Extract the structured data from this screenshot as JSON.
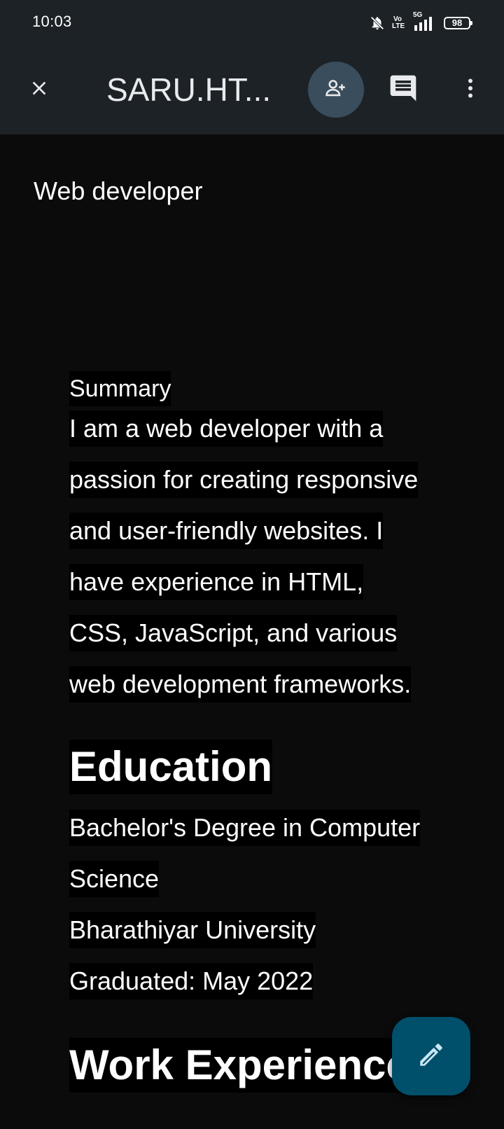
{
  "status_bar": {
    "time": "10:03",
    "volte_label": "Vo LTE",
    "network": "5G",
    "battery": "98",
    "icons": [
      "bell-off-icon",
      "volte-icon",
      "signal-icon",
      "battery-icon"
    ]
  },
  "app_bar": {
    "title": "SARU.HT...",
    "icons": [
      "close-icon",
      "person-add-icon",
      "comment-icon",
      "more-vert-icon"
    ],
    "share_bg_color": "#394d5c"
  },
  "document": {
    "subtitle": "Web developer",
    "summary_label": "Summary",
    "summary_lines": [
      "I am a web developer with a",
      "passion for creating responsive",
      "and user-friendly websites. I",
      "have experience in HTML,",
      "CSS, JavaScript, and various",
      "web development frameworks."
    ],
    "education_heading": "Education",
    "education_lines": [
      "Bachelor's Degree in Computer",
      "Science",
      "Bharathiyar University",
      "Graduated: May 2022"
    ],
    "work_heading": "Work Experience"
  },
  "fab": {
    "icon": "edit-pencil-icon",
    "color": "#004f6b"
  },
  "colors": {
    "background": "#0b0b0b",
    "bar": "#1d2227",
    "text": "#ffffff"
  }
}
